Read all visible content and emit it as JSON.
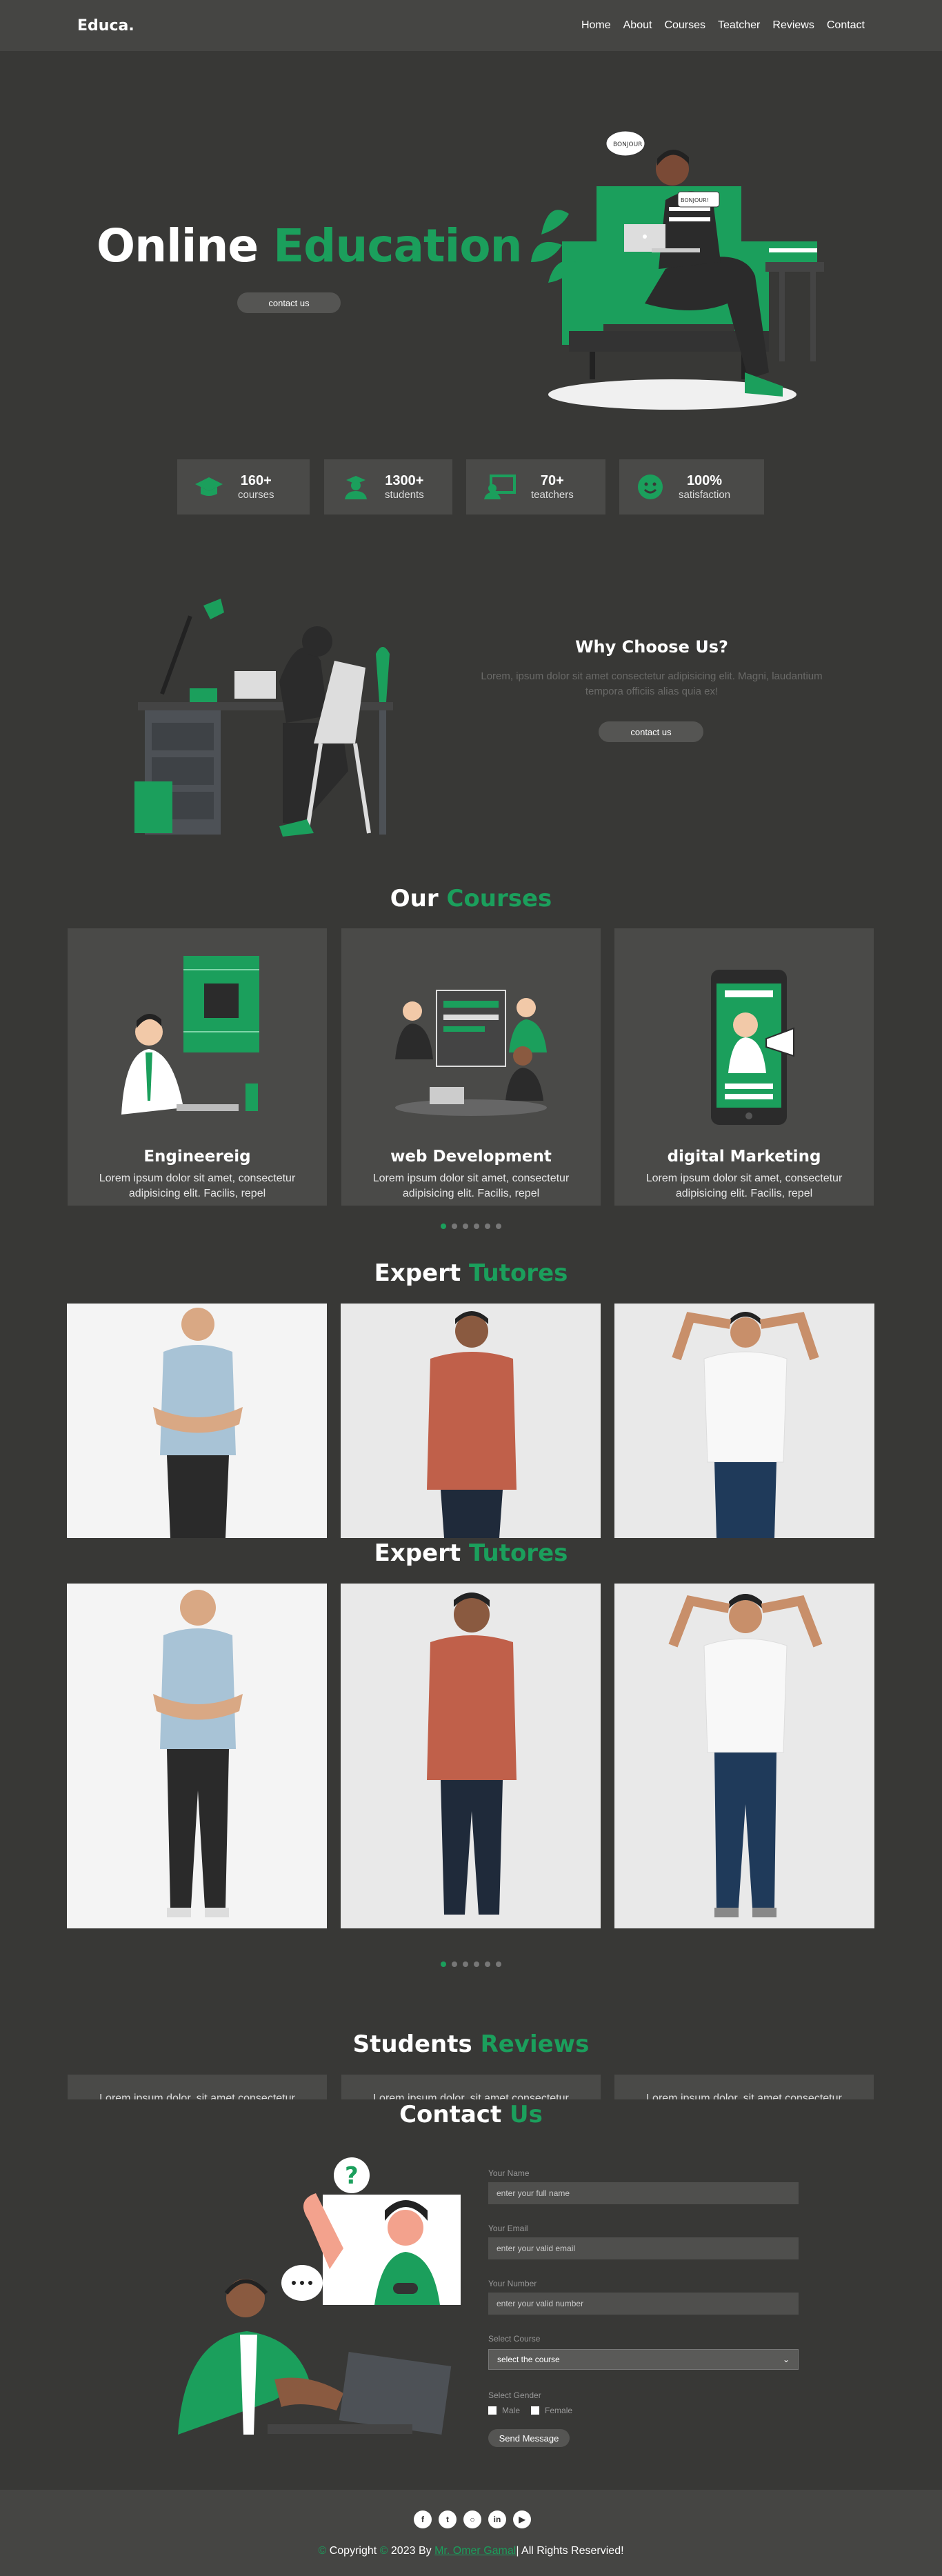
{
  "header": {
    "logo": "Educa.",
    "nav": [
      "Home",
      "About",
      "Courses",
      "Teatcher",
      "Reviews",
      "Contact"
    ]
  },
  "hero": {
    "title_part1": "Online",
    "title_part2": "Education",
    "button": "contact us",
    "bubble_left": "BONJOUR",
    "bubble_right": "BONJOUR!"
  },
  "stats": [
    {
      "num": "160+",
      "label": "courses",
      "icon": "graduation-cap-icon"
    },
    {
      "num": "1300+",
      "label": "students",
      "icon": "user-graduate-icon"
    },
    {
      "num": "70+",
      "label": "teatchers",
      "icon": "chalkboard-teacher-icon"
    },
    {
      "num": "100%",
      "label": "satisfaction",
      "icon": "smile-icon"
    }
  ],
  "why": {
    "title": "Why Choose Us?",
    "text": "Lorem, ipsum dolor sit amet consectetur adipisicing elit. Magni, laudantium tempora officiis alias quia ex!",
    "button": "contact us"
  },
  "courses": {
    "title_part1": "Our",
    "title_part2": "Courses",
    "items": [
      {
        "title": "Engineereig",
        "desc": "Lorem ipsum dolor sit amet, consectetur adipisicing elit. Facilis, repel"
      },
      {
        "title": "web Development",
        "desc": "Lorem ipsum dolor sit amet, consectetur adipisicing elit. Facilis, repel"
      },
      {
        "title": "digital Marketing",
        "desc": "Lorem ipsum dolor sit amet, consectetur adipisicing elit. Facilis, repel"
      }
    ]
  },
  "tutors": {
    "title_part1": "Expert",
    "title_part2": "Tutores"
  },
  "reviews": {
    "title_part1": "Students",
    "title_part2": "Reviews",
    "snippet": "Lorem ipsum dolor, sit amet consectetur"
  },
  "contact": {
    "title_part1": "Contact",
    "title_part2": "Us",
    "name_label": "Your Name",
    "name_placeholder": "enter your full name",
    "email_label": "Your Email",
    "email_placeholder": "enter your valid email",
    "number_label": "Your Number",
    "number_placeholder": "enter your valid number",
    "course_label": "Select Course",
    "course_value": "select the course",
    "gender_label": "Select Gender",
    "gender_male": "Male",
    "gender_female": "Female",
    "submit": "Send Message"
  },
  "footer": {
    "socials": [
      "facebook-icon",
      "twitter-icon",
      "instagram-icon",
      "linkedin-icon",
      "youtube-icon"
    ],
    "copyright_prefix": "Copyright",
    "year": "2023 By",
    "author": "Mr. Omer Gamal",
    "suffix": "| All Rights Reservied!"
  },
  "colors": {
    "accent": "#1b9f5c",
    "background": "#383836",
    "header": "#454543"
  }
}
